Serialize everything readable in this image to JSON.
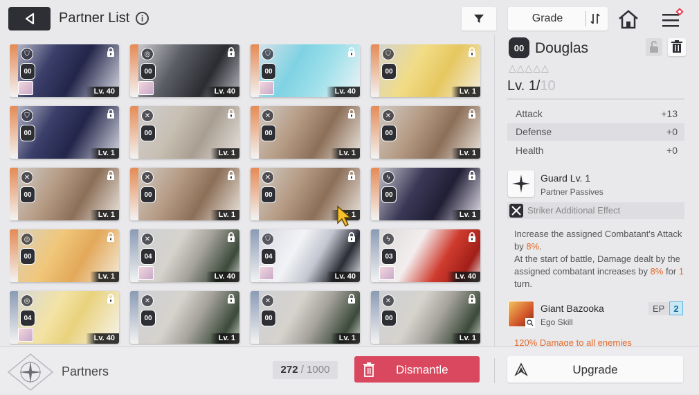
{
  "header": {
    "back_icon": "back-arrow-icon",
    "title": "Partner List",
    "info_glyph": "i",
    "filter_icon": "funnel-icon",
    "sort_label": "Grade",
    "sort_icon": "sort-order-icon",
    "home_icon": "home-icon",
    "menu_icon": "menu-icon"
  },
  "cards": [
    {
      "rank": "00",
      "level": "Lv. 40",
      "class": "shield",
      "tone": "navy",
      "strip": "#e58a55",
      "mini": true
    },
    {
      "rank": "00",
      "level": "Lv. 40",
      "class": "target",
      "tone": "mecha",
      "strip": "#e58a55",
      "mini": true
    },
    {
      "rank": "00",
      "level": "Lv. 40",
      "class": "shield",
      "tone": "cyan",
      "strip": "#e58a55",
      "mini": true
    },
    {
      "rank": "00",
      "level": "Lv. 1",
      "class": "shield",
      "tone": "blonde",
      "strip": "#e58a55",
      "mini": false
    },
    {
      "rank": "00",
      "level": "Lv. 1",
      "class": "shield",
      "tone": "navy",
      "strip": "#e58a55",
      "mini": false
    },
    {
      "rank": "00",
      "level": "Lv. 1",
      "class": "swords",
      "tone": "ash",
      "strip": "#e58a55",
      "mini": false
    },
    {
      "rank": "00",
      "level": "Lv. 1",
      "class": "swords",
      "tone": "brown",
      "strip": "#e58a55",
      "mini": false
    },
    {
      "rank": "00",
      "level": "Lv. 1",
      "class": "swords",
      "tone": "brown",
      "strip": "#e58a55",
      "mini": false
    },
    {
      "rank": "00",
      "level": "Lv. 1",
      "class": "swords",
      "tone": "brown",
      "strip": "#e58a55",
      "mini": false
    },
    {
      "rank": "00",
      "level": "Lv. 1",
      "class": "swords",
      "tone": "brown",
      "strip": "#e58a55",
      "mini": false
    },
    {
      "rank": "00",
      "level": "Lv. 1",
      "class": "swords",
      "tone": "brown",
      "strip": "#e58a55",
      "mini": false
    },
    {
      "rank": "00",
      "level": "Lv. 1",
      "class": "bolt",
      "tone": "violet",
      "strip": "#e58a55",
      "mini": false
    },
    {
      "rank": "00",
      "level": "Lv. 1",
      "class": "target",
      "tone": "gold",
      "strip": "#e58a55",
      "mini": false
    },
    {
      "rank": "04",
      "level": "Lv. 40",
      "class": "swords",
      "tone": "bear",
      "strip": "#8a9bb5",
      "mini": true
    },
    {
      "rank": "04",
      "level": "Lv. 40",
      "class": "shield",
      "tone": "white",
      "strip": "#8a9bb5",
      "mini": true
    },
    {
      "rank": "03",
      "level": "Lv. 40",
      "class": "bolt",
      "tone": "red",
      "strip": "#8a9bb5",
      "mini": true
    },
    {
      "rank": "04",
      "level": "Lv. 40",
      "class": "target",
      "tone": "blonde2",
      "strip": "#8a9bb5",
      "mini": true
    },
    {
      "rank": "00",
      "level": "Lv. 1",
      "class": "swords",
      "tone": "bear",
      "strip": "#8a9bb5",
      "mini": false
    },
    {
      "rank": "00",
      "level": "Lv. 1",
      "class": "swords",
      "tone": "bear",
      "strip": "#8a9bb5",
      "mini": false
    },
    {
      "rank": "00",
      "level": "Lv. 1",
      "class": "swords",
      "tone": "bear",
      "strip": "#8a9bb5",
      "mini": false
    }
  ],
  "detail": {
    "rank": "00",
    "name": "Douglas",
    "stars": "△△△△△",
    "level_prefix": "Lv. 1/",
    "level_max": "10",
    "lock_icon": "unlock-icon",
    "trash_icon": "trash-icon",
    "stats": [
      {
        "label": "Attack",
        "value": "+13"
      },
      {
        "label": "Defense",
        "value": "+0"
      },
      {
        "label": "Health",
        "value": "+0"
      }
    ],
    "passive": {
      "name": "Guard Lv. 1",
      "type": "Partner Passives",
      "icon": "sparkle-icon"
    },
    "striker_label": "Striker Additional Effect",
    "desc_1": "Increase the assigned Combatant's Attack by ",
    "desc_1_hl": "8%",
    "desc_1_end": ".",
    "desc_2": "At the start of battle, Damage dealt by the assigned combatant increases by ",
    "desc_2_hl": "8%",
    "desc_2_mid": " for ",
    "desc_2_hl2": "1",
    "desc_2_end": " turn.",
    "ego": {
      "name": "Giant Bazooka",
      "type": "Ego Skill",
      "ep_label": "EP",
      "ep_value": "2"
    },
    "cut_text": "120% Damage to all enemies"
  },
  "footer": {
    "partners_label": "Partners",
    "count_current": "272",
    "count_sep": " / ",
    "count_total": "1000",
    "dismantle_label": "Dismantle",
    "upgrade_label": "Upgrade"
  },
  "colors": {
    "dark": "#2e2f34",
    "dismantle": "#d9485e",
    "highlight": "#e46a2a",
    "ep": "#5bb5de"
  }
}
